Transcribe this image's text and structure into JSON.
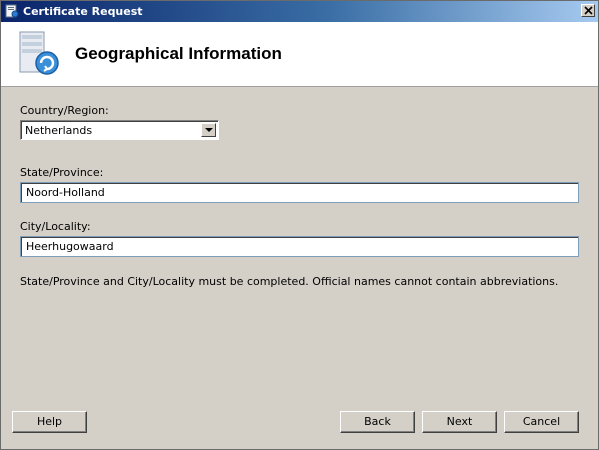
{
  "window": {
    "title": "Certificate Request",
    "close_icon": "close-icon"
  },
  "header": {
    "title": "Geographical Information",
    "icon": "certificate-server-icon"
  },
  "form": {
    "country_label": "Country/Region:",
    "country_value": "Netherlands",
    "state_label": "State/Province:",
    "state_value": "Noord-Holland",
    "city_label": "City/Locality:",
    "city_value": "Heerhugowaard",
    "info_text": "State/Province and City/Locality must be completed. Official names cannot contain abbreviations."
  },
  "buttons": {
    "help": "Help",
    "back": "Back",
    "next": "Next",
    "cancel": "Cancel"
  },
  "colors": {
    "titlebar_start": "#0a246a",
    "titlebar_end": "#a6caf0",
    "dialog_bg": "#d4d0c8",
    "header_bg": "#ffffff"
  }
}
